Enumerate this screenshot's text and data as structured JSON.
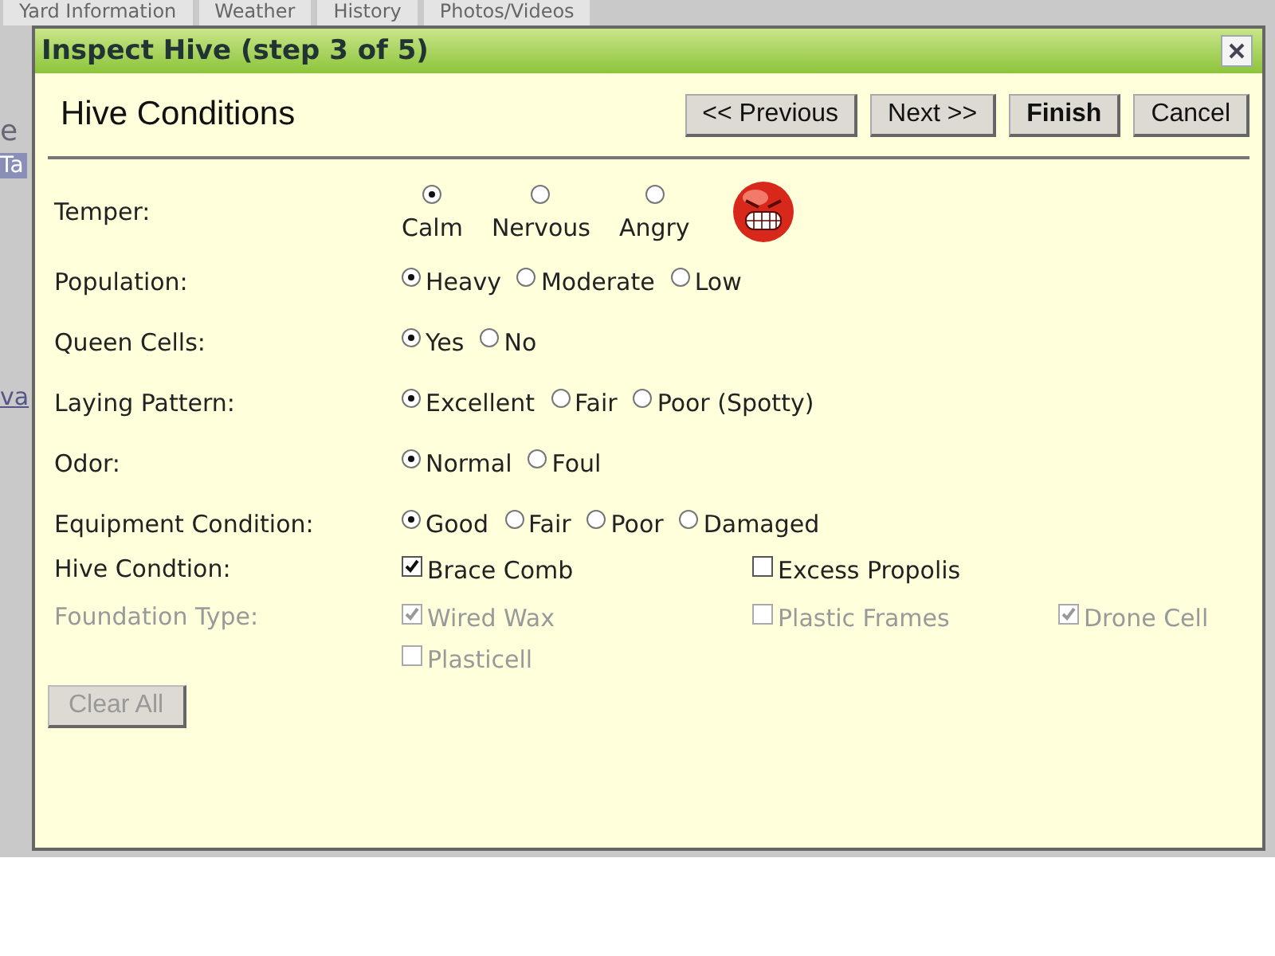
{
  "background": {
    "tabs": [
      "Yard Information",
      "Weather",
      "History",
      "Photos/Videos"
    ],
    "fragments": [
      "e",
      "Ta",
      "va"
    ]
  },
  "dialog": {
    "title": "Inspect Hive (step 3 of 5)",
    "heading": "Hive Conditions",
    "buttons": [
      {
        "label": "<< Previous",
        "bold": false
      },
      {
        "label": "Next >>",
        "bold": false
      },
      {
        "label": "Finish",
        "bold": true
      },
      {
        "label": "Cancel",
        "bold": false
      }
    ],
    "fields": [
      {
        "label": "Temper:",
        "kind": "radio-stacked",
        "disabled": false,
        "options": [
          {
            "label": "Calm",
            "selected": true
          },
          {
            "label": "Nervous",
            "selected": false
          },
          {
            "label": "Angry",
            "selected": false
          }
        ]
      },
      {
        "label": "Population:",
        "kind": "radio",
        "disabled": false,
        "options": [
          {
            "label": "Heavy",
            "selected": true
          },
          {
            "label": "Moderate",
            "selected": false
          },
          {
            "label": "Low",
            "selected": false
          }
        ]
      },
      {
        "label": "Queen Cells:",
        "kind": "radio",
        "disabled": false,
        "options": [
          {
            "label": "Yes",
            "selected": true
          },
          {
            "label": "No",
            "selected": false
          }
        ]
      },
      {
        "label": "Laying Pattern:",
        "kind": "radio",
        "disabled": false,
        "options": [
          {
            "label": "Excellent",
            "selected": true
          },
          {
            "label": "Fair",
            "selected": false
          },
          {
            "label": "Poor (Spotty)",
            "selected": false
          }
        ]
      },
      {
        "label": "Odor:",
        "kind": "radio",
        "disabled": false,
        "options": [
          {
            "label": "Normal",
            "selected": true
          },
          {
            "label": "Foul",
            "selected": false
          }
        ]
      },
      {
        "label": "Equipment Condition:",
        "kind": "radio",
        "disabled": false,
        "options": [
          {
            "label": "Good",
            "selected": true
          },
          {
            "label": "Fair",
            "selected": false
          },
          {
            "label": "Poor",
            "selected": false
          },
          {
            "label": "Damaged",
            "selected": false
          }
        ]
      },
      {
        "label": "Hive Condtion:",
        "kind": "checkbox",
        "disabled": false,
        "options": [
          {
            "label": "Brace Comb",
            "checked": true
          },
          {
            "label": "Excess Propolis",
            "checked": false
          }
        ]
      },
      {
        "label": "Foundation Type:",
        "kind": "checkbox",
        "disabled": true,
        "options": [
          {
            "label": "Wired Wax",
            "checked": true
          },
          {
            "label": "Plastic Frames",
            "checked": false
          },
          {
            "label": "Drone Cell",
            "checked": true
          },
          {
            "label": "Plasticell",
            "checked": false
          }
        ]
      }
    ],
    "clear_button": {
      "label": "Clear All",
      "disabled": true
    }
  }
}
